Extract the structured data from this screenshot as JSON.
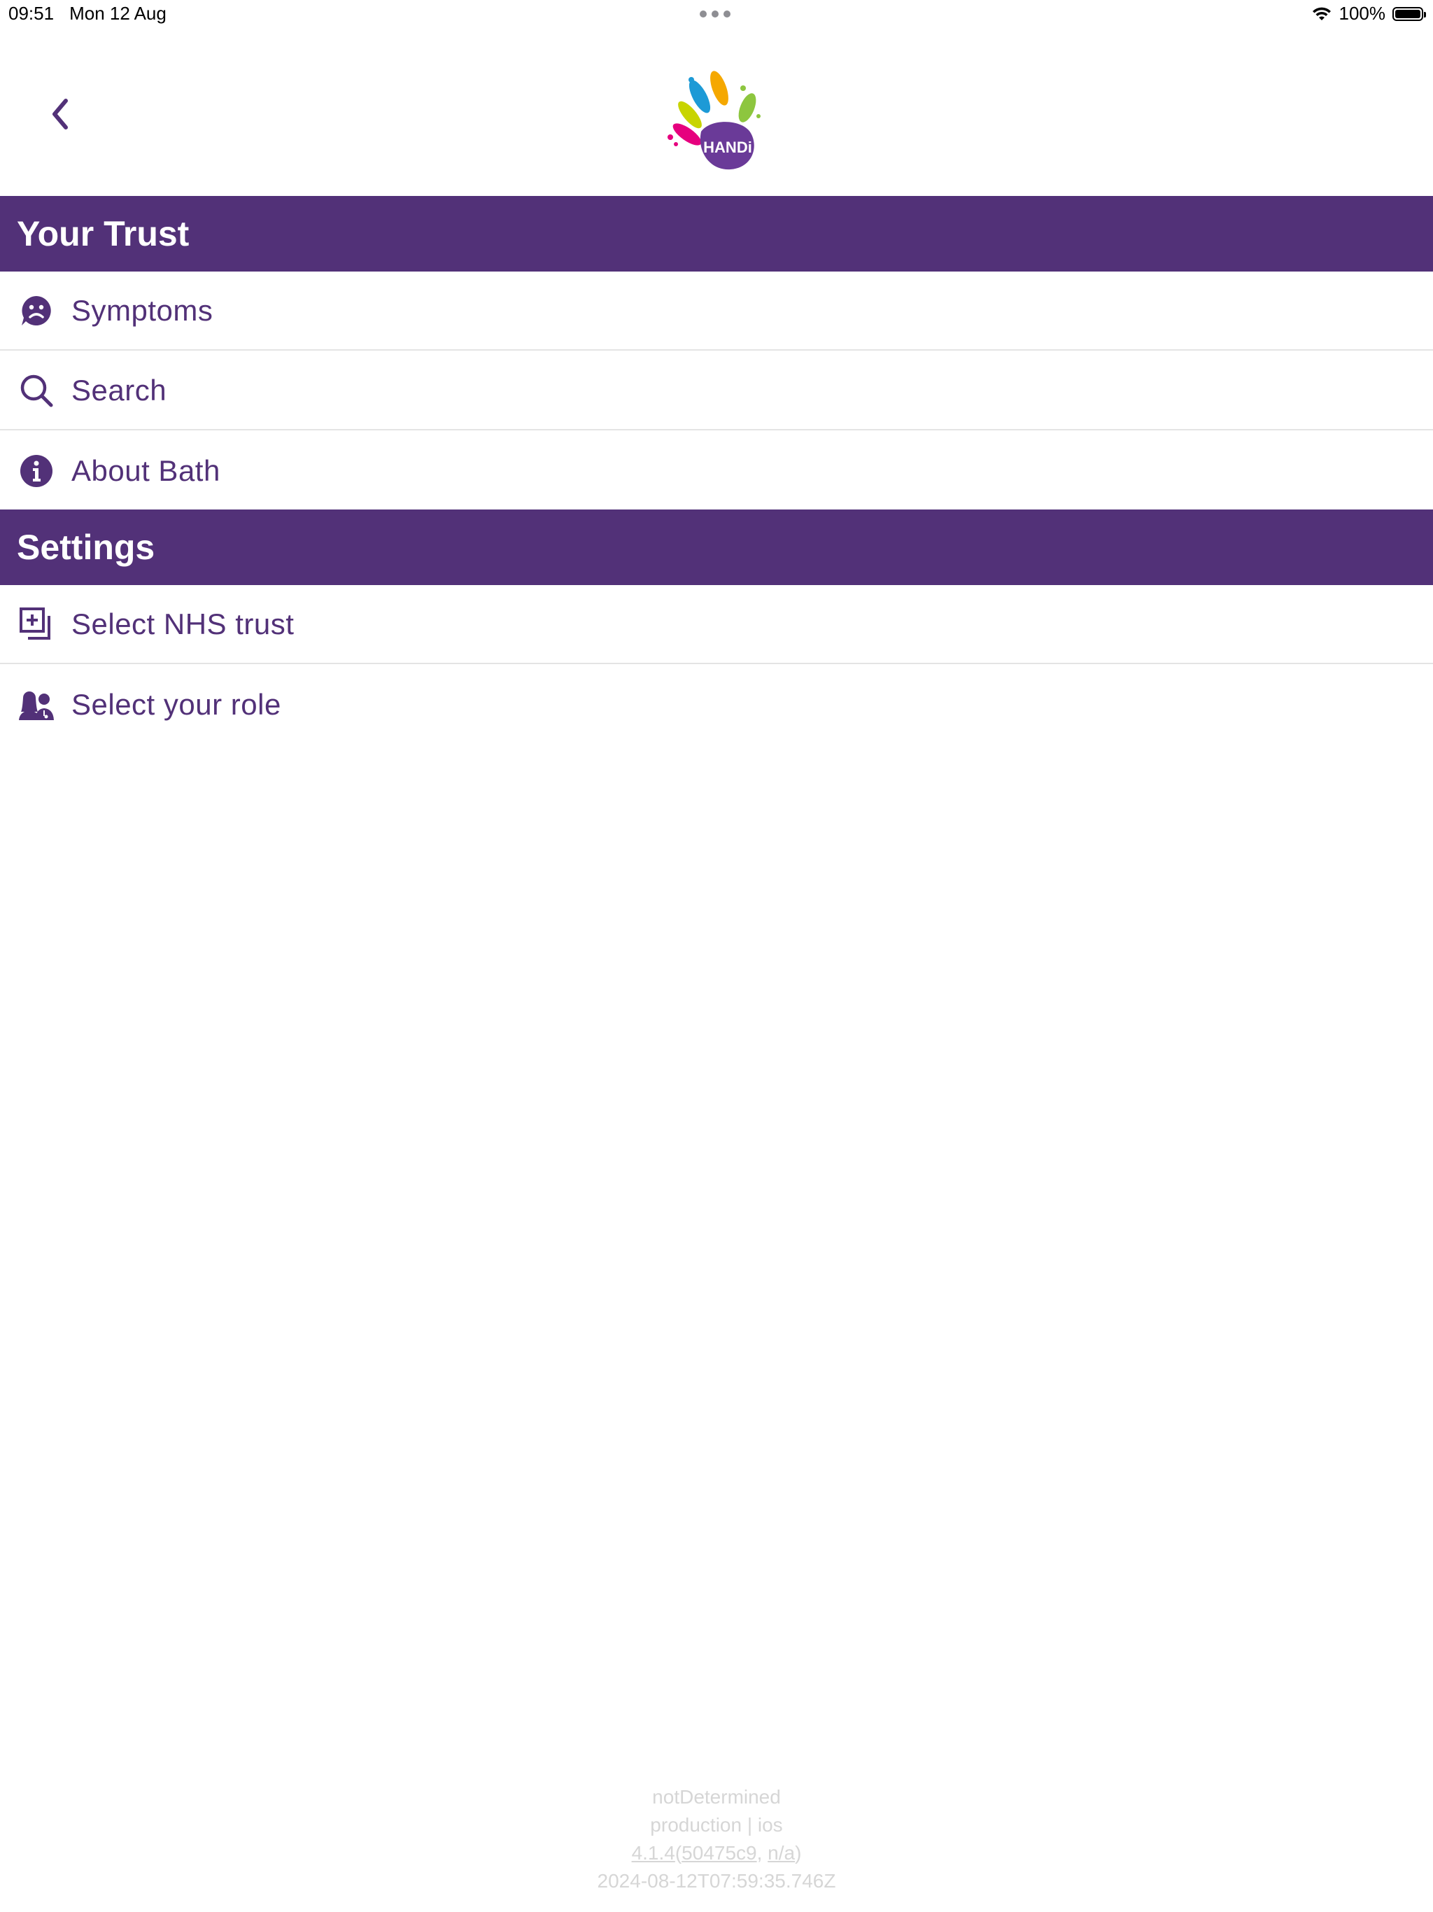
{
  "status_bar": {
    "time": "09:51",
    "date": "Mon 12 Aug",
    "battery": "100%"
  },
  "header": {
    "logo_text": "HANDi",
    "back_icon": "chevron-left-icon"
  },
  "sections": [
    {
      "title": "Your Trust",
      "items": [
        {
          "label": "Symptoms",
          "icon": "sad-face-icon"
        },
        {
          "label": "Search",
          "icon": "search-icon"
        },
        {
          "label": "About Bath",
          "icon": "info-icon"
        }
      ]
    },
    {
      "title": "Settings",
      "items": [
        {
          "label": "Select NHS trust",
          "icon": "add-document-icon"
        },
        {
          "label": "Select your role",
          "icon": "people-icon"
        }
      ]
    }
  ],
  "footer": {
    "line1": "notDetermined",
    "line2": "production | ios",
    "version": "4.1.4",
    "open_paren": "(",
    "commit": "50475c9",
    "comma": ", ",
    "build": "n/a",
    "close_paren": ")",
    "timestamp": "2024-08-12T07:59:35.746Z"
  },
  "colors": {
    "brand_purple": "#523178",
    "divider": "#e4e4e4",
    "footer_text": "#d6d6d6"
  }
}
